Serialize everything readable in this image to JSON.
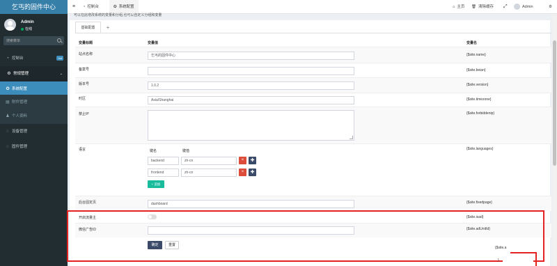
{
  "app": {
    "logo": "乞丐的固件中心"
  },
  "user": {
    "name": "Admin",
    "status": "在线"
  },
  "sidebar": {
    "search_placeholder": "搜索菜单",
    "items": [
      {
        "label": "控制台",
        "badge": "hot",
        "icon": "dashboard-icon"
      },
      {
        "label": "常规管理",
        "icon": "cogs-icon"
      },
      {
        "label": "系统配置",
        "icon": "cog-icon"
      },
      {
        "label": "附件管理",
        "icon": "file-icon"
      },
      {
        "label": "个人资料",
        "icon": "user-icon"
      },
      {
        "label": "设备管理",
        "icon": "circle-icon"
      },
      {
        "label": "固件管理",
        "icon": "circle-icon"
      }
    ]
  },
  "topbar": {
    "tabs": [
      {
        "label": "控制台",
        "icon": "dashboard-icon"
      },
      {
        "label": "系统配置",
        "icon": "cog-icon"
      }
    ],
    "home": "主页",
    "clear_cache": "清除缓存",
    "admin": "Admin"
  },
  "notice": "可以在此增改系统的变量和分组,也可以自定义分组和变量",
  "config_tabs": {
    "base": "基础配置",
    "add": "+"
  },
  "table": {
    "headers": {
      "title": "变量标题",
      "value": "变量值",
      "name": "变量名"
    },
    "rows": [
      {
        "label": "站点名称",
        "value": "乞丐的固件中心",
        "var": "{$site.name}"
      },
      {
        "label": "备案号",
        "value": "",
        "var": "{$site.beian}"
      },
      {
        "label": "版本号",
        "value": "1.0.2",
        "var": "{$site.version}"
      },
      {
        "label": "时区",
        "value": "Asia/Shanghai",
        "var": "{$site.timezone}"
      },
      {
        "label": "禁止IP",
        "value": "",
        "var": "{$site.forbiddenip}"
      },
      {
        "label": "语言",
        "var": "{$site.languages}"
      },
      {
        "label": "后台固定页",
        "value": "dashboard",
        "var": "{$site.fixedpage}"
      },
      {
        "label": "开启流量主",
        "var": "{$site.isad}"
      },
      {
        "label": "微信广告ID",
        "value": "",
        "var": "{$site.adUnitId}"
      }
    ],
    "languages": {
      "key_header": "键名",
      "value_header": "键值",
      "pairs": [
        {
          "key": "backend",
          "value": "zh-cn"
        },
        {
          "key": "frontend",
          "value": "zh-cn"
        }
      ],
      "add_label": "+ 追加",
      "delete_symbol": "×",
      "move_symbol": "✚"
    },
    "cut_var": "{$site.a",
    "cut_bracket": "}"
  },
  "buttons": {
    "ok": "确定",
    "reset": "重置"
  },
  "colors": {
    "sidebar": "#222d32",
    "active": "#3c8dbc",
    "danger": "#dd4b39",
    "success": "#18bc9c",
    "highlight": "#e52121"
  }
}
